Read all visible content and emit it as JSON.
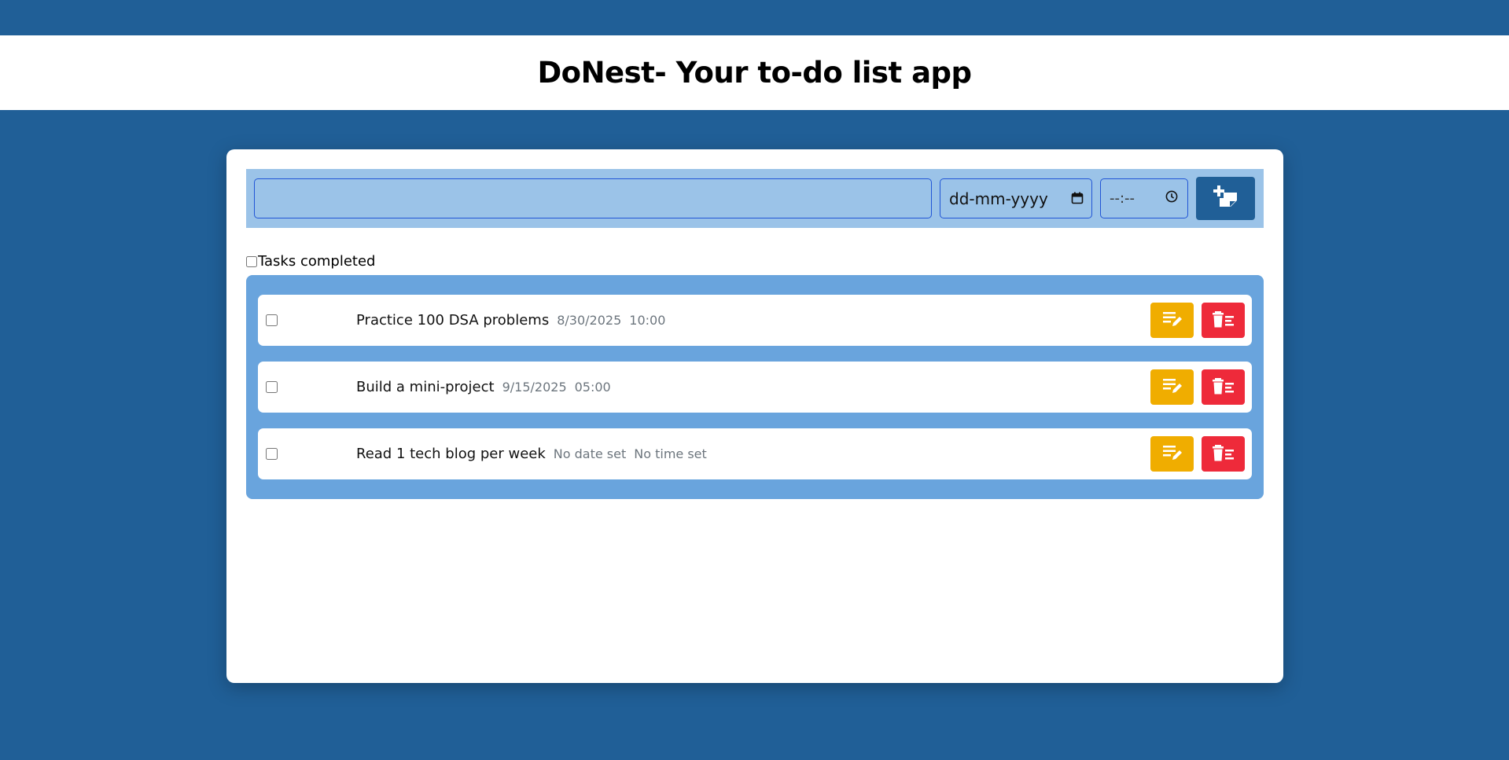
{
  "app": {
    "title": "DoNest- Your to-do list app"
  },
  "input_bar": {
    "task_value": "",
    "date_placeholder": "dd-mm-yyyy",
    "time_placeholder": "--:--",
    "add_icon": "add-note-icon"
  },
  "completed_filter": {
    "label": "Tasks completed",
    "checked": false
  },
  "tasks": [
    {
      "text": "Practice 100 DSA problems",
      "date": "8/30/2025",
      "time": "10:00",
      "done": false
    },
    {
      "text": "Build a mini-project",
      "date": "9/15/2025",
      "time": "05:00",
      "done": false
    },
    {
      "text": "Read 1 tech blog per week",
      "date": "No date set",
      "time": "No time set",
      "done": false
    }
  ],
  "colors": {
    "background": "#205f97",
    "input_bar": "#9bc3e8",
    "task_panel": "#69a4dd",
    "edit": "#f0ad00",
    "delete": "#ee2a3a"
  }
}
